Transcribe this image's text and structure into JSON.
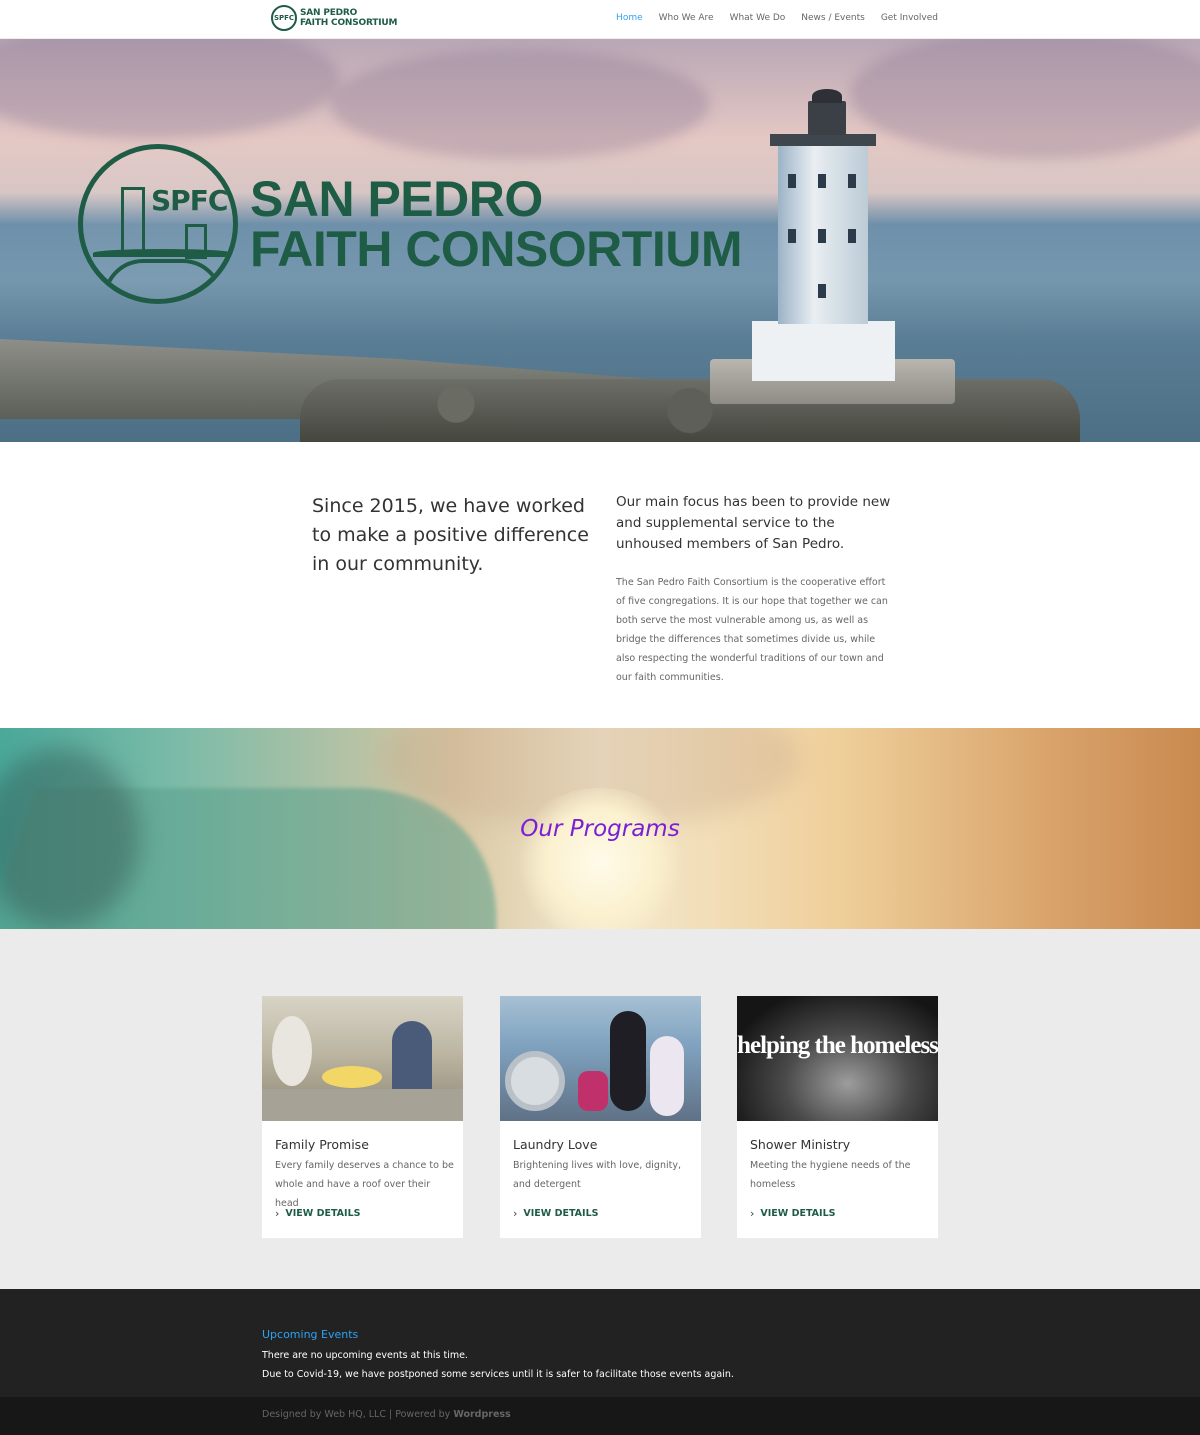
{
  "header": {
    "logo_line1": "SAN PEDRO",
    "logo_line2": "FAITH CONSORTIUM",
    "logo_mark": "SPFC",
    "nav": [
      {
        "label": "Home",
        "active": true
      },
      {
        "label": "Who We Are",
        "active": false
      },
      {
        "label": "What We Do",
        "active": false
      },
      {
        "label": "News / Events",
        "active": false
      },
      {
        "label": "Get Involved",
        "active": false
      }
    ]
  },
  "hero": {
    "seal_text": "SPFC",
    "title_line1": "SAN PEDRO",
    "title_line2": "FAITH CONSORTIUM"
  },
  "intro": {
    "heading": "Since 2015, we have worked to make a positive difference in our community.",
    "subheading": "Our main focus has been to provide new and supplemental service to the unhoused members of San Pedro.",
    "body": "The San Pedro Faith Consortium is the cooperative effort of five congregations. It is our hope that together we can both serve the most vulnerable among us, as well as bridge the differences that sometimes divide us, while also respecting the wonderful traditions of our town and our faith communities."
  },
  "programs": {
    "title": "Our Programs",
    "cards": [
      {
        "title": "Family Promise",
        "description": "Every family deserves a chance to be whole and have a roof over their head",
        "link": "VIEW DETAILS"
      },
      {
        "title": "Laundry Love",
        "description": "Brightening lives with love, dignity, and detergent",
        "link": "VIEW DETAILS"
      },
      {
        "title": "Shower Ministry",
        "description": "Meeting the hygiene needs of the homeless",
        "link": "VIEW DETAILS",
        "image_text": "helping the homeless"
      }
    ]
  },
  "footer": {
    "events_title": "Upcoming Events",
    "line1": "There are no upcoming events at this time.",
    "line2": "Due to Covid-19, we have postponed some services until it is safer to facilitate those events again.",
    "credits_prefix": "Designed by Web HQ, LLC | Powered by ",
    "credits_wp": "Wordpress"
  },
  "colors": {
    "brand_green": "#1e5c46",
    "link_blue": "#2ea3f2",
    "programs_title": "#7b1fd6",
    "footer_bg": "#222222"
  }
}
